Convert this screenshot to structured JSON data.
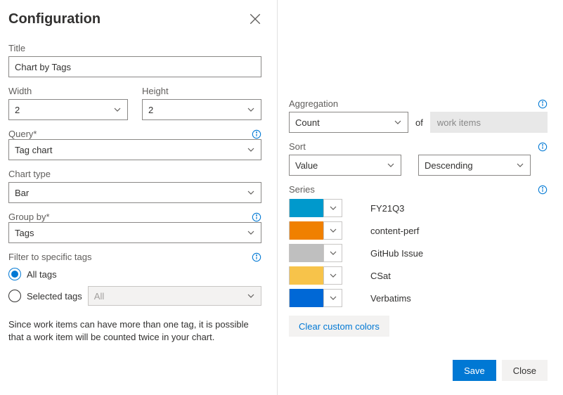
{
  "header": {
    "title": "Configuration"
  },
  "left": {
    "title_label": "Title",
    "title_value": "Chart by Tags",
    "width_label": "Width",
    "width_value": "2",
    "height_label": "Height",
    "height_value": "2",
    "query_label": "Query*",
    "query_value": "Tag chart",
    "chart_type_label": "Chart type",
    "chart_type_value": "Bar",
    "group_by_label": "Group by*",
    "group_by_value": "Tags",
    "filter_label": "Filter to specific tags",
    "radio_all": "All tags",
    "radio_selected": "Selected tags",
    "selected_tags_placeholder": "All",
    "note": "Since work items can have more than one tag, it is possible that a work item will be counted twice in your chart."
  },
  "right": {
    "aggregation_label": "Aggregation",
    "aggregation_value": "Count",
    "of_text": "of",
    "of_value": "work items",
    "sort_label": "Sort",
    "sort_field": "Value",
    "sort_order": "Descending",
    "series_label": "Series",
    "series": [
      {
        "color": "#0099cc",
        "name": "FY21Q3"
      },
      {
        "color": "#f08000",
        "name": "content-perf"
      },
      {
        "color": "#bfbfbf",
        "name": "GitHub Issue"
      },
      {
        "color": "#f7c34a",
        "name": "CSat"
      },
      {
        "color": "#0068d6",
        "name": "Verbatims"
      }
    ],
    "clear_colors": "Clear custom colors",
    "save": "Save",
    "close": "Close"
  }
}
